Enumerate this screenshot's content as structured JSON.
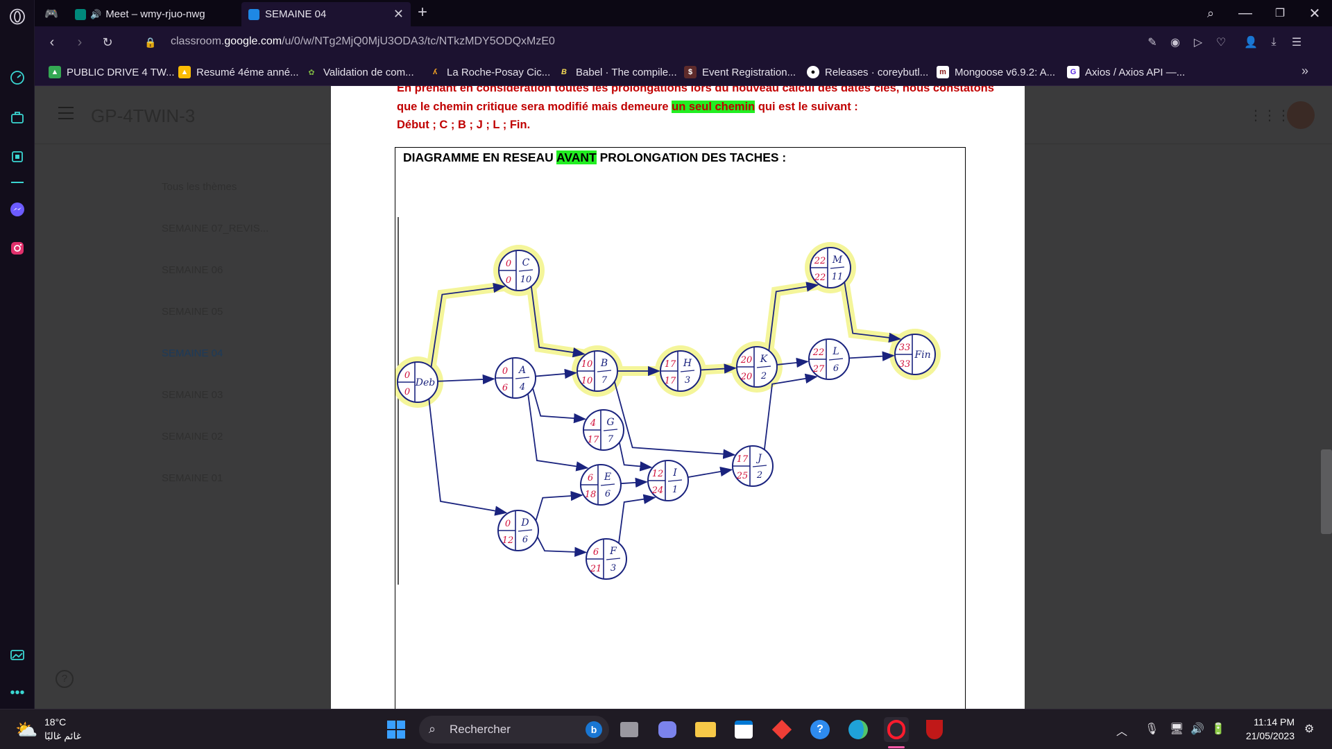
{
  "browser": {
    "tabs": [
      {
        "label": "Meet – wmy-rjuo-nwg",
        "active": false
      },
      {
        "label": "SEMAINE 04",
        "active": true
      }
    ],
    "url_prefix": "classroom.",
    "url_domain": "google.com",
    "url_path": "/u/0/w/NTg2MjQ0MjU3ODA3/tc/NTkzMDY5ODQxMzE0",
    "bookmarks": [
      "PUBLIC DRIVE 4 TW...",
      "Resumé 4éme anné...",
      "Validation de com...",
      "La Roche-Posay Cic...",
      "Babel · The compile...",
      "Event Registration...",
      "Releases · coreybutl...",
      "Mongoose v6.9.2: A...",
      "Axios / Axios API —..."
    ]
  },
  "classroom": {
    "title": "GP-4TWIN-3",
    "topics": [
      "Tous les thèmes",
      "SEMAINE 07_REVIS...",
      "SEMAINE 06",
      "SEMAINE 05",
      "SEMAINE 04",
      "SEMAINE 03",
      "SEMAINE 02",
      "SEMAINE 01"
    ],
    "active_topic": "SEMAINE 04"
  },
  "document": {
    "line1": "En prenant en considération toutes les prolongations lors du nouveau calcul des dates clés, nous constatons",
    "line2_a": "que le chemin critique sera modifié mais demeure ",
    "line2_hl": "un seul chemin",
    "line2_b": " qui est le suivant :",
    "line3": "Début ; C ; B ; J ; L ; Fin.",
    "diagram_title_a": "DIAGRAMME EN RESEAU ",
    "diagram_title_hl": "AVANT",
    "diagram_title_b": " PROLONGATION DES TACHES :"
  },
  "network": {
    "nodes": [
      {
        "id": "Deb",
        "early": "0",
        "late": "0",
        "name": "Deb",
        "dur": "",
        "critical": true
      },
      {
        "id": "C",
        "early": "0",
        "late": "0",
        "name": "C",
        "dur": "10",
        "critical": true
      },
      {
        "id": "A",
        "early": "0",
        "late": "6",
        "name": "A",
        "dur": "4",
        "critical": false
      },
      {
        "id": "B",
        "early": "10",
        "late": "10",
        "name": "B",
        "dur": "7",
        "critical": true
      },
      {
        "id": "H",
        "early": "17",
        "late": "17",
        "name": "H",
        "dur": "3",
        "critical": true
      },
      {
        "id": "K",
        "early": "20",
        "late": "20",
        "name": "K",
        "dur": "2",
        "critical": true
      },
      {
        "id": "M",
        "early": "22",
        "late": "22",
        "name": "M",
        "dur": "11",
        "critical": true
      },
      {
        "id": "L",
        "early": "22",
        "late": "27",
        "name": "L",
        "dur": "6",
        "critical": false
      },
      {
        "id": "Fin",
        "early": "33",
        "late": "33",
        "name": "Fin",
        "dur": "",
        "critical": true
      },
      {
        "id": "G",
        "early": "4",
        "late": "17",
        "name": "G",
        "dur": "7",
        "critical": false
      },
      {
        "id": "E",
        "early": "6",
        "late": "18",
        "name": "E",
        "dur": "6",
        "critical": false
      },
      {
        "id": "I",
        "early": "12",
        "late": "24",
        "name": "I",
        "dur": "1",
        "critical": false
      },
      {
        "id": "J",
        "early": "17",
        "late": "25",
        "name": "J",
        "dur": "2",
        "critical": false
      },
      {
        "id": "D",
        "early": "0",
        "late": "12",
        "name": "D",
        "dur": "6",
        "critical": false
      },
      {
        "id": "F",
        "early": "6",
        "late": "21",
        "name": "F",
        "dur": "3",
        "critical": false
      }
    ],
    "edges": [
      [
        "Deb",
        "C"
      ],
      [
        "Deb",
        "A"
      ],
      [
        "Deb",
        "D"
      ],
      [
        "C",
        "B"
      ],
      [
        "A",
        "B"
      ],
      [
        "A",
        "G"
      ],
      [
        "A",
        "E"
      ],
      [
        "B",
        "H"
      ],
      [
        "B",
        "J"
      ],
      [
        "H",
        "K"
      ],
      [
        "K",
        "M"
      ],
      [
        "K",
        "L"
      ],
      [
        "M",
        "Fin"
      ],
      [
        "L",
        "Fin"
      ],
      [
        "G",
        "I"
      ],
      [
        "E",
        "I"
      ],
      [
        "D",
        "E"
      ],
      [
        "D",
        "F"
      ],
      [
        "F",
        "I"
      ],
      [
        "I",
        "J"
      ],
      [
        "J",
        "L"
      ]
    ]
  },
  "taskbar": {
    "weather_temp": "18°C",
    "weather_desc": "غائم غالبًا",
    "search_placeholder": "Rechercher",
    "time": "11:14 PM",
    "date": "21/05/2023"
  },
  "colors": {
    "accent_red": "#c00000",
    "highlight": "#22ee22",
    "ink_blue": "#1a237e",
    "ink_red": "#d0103a",
    "marker_yellow": "#f4f59a"
  }
}
